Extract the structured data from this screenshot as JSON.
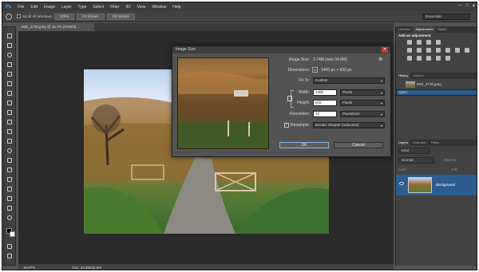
{
  "app": {
    "logo": "Ps",
    "menu": [
      "File",
      "Edit",
      "Image",
      "Layer",
      "Type",
      "Select",
      "Filter",
      "3D",
      "View",
      "Window",
      "Help"
    ],
    "window_controls": [
      "—",
      "□",
      "✕"
    ]
  },
  "options_bar": {
    "scroll_all_windows": "Scroll All Windows",
    "buttons": [
      "100%",
      "Fit Screen",
      "Fill Screen"
    ],
    "workspace": "Essentials"
  },
  "document": {
    "tab_title": "IMG_3730.jpeg @ 16.7% (RGB/8)",
    "zoom": "16.67%",
    "doc_info": "Doc: 34.8M/34.8M"
  },
  "right_panel": {
    "top_tabs": [
      "Libraries",
      "Adjustments",
      "Styles"
    ],
    "adjustments_title": "Add an adjustment",
    "history_tabs": [
      "History",
      "Actions"
    ],
    "history_items": [
      "IMG_3730.jpeg",
      "Open"
    ],
    "layers_tabs": [
      "Layers",
      "Channels",
      "Paths"
    ],
    "layer_filter": "Kind",
    "blend_mode": "Normal",
    "opacity_label": "Opacity:",
    "lock_label": "Lock:",
    "fill_label": "Fill:",
    "layer_name": "Background"
  },
  "dialog": {
    "title": "Image Size",
    "close": "✕",
    "image_size_label": "Image Size:",
    "image_size_value": "3.74M (was 34.8M)",
    "dimensions_label": "Dimensions:",
    "dimensions_value": "1400 px  ×  933 px",
    "fit_to_label": "Fit To:",
    "fit_to_value": "Custom",
    "width_label": "Width:",
    "width_value": "1400",
    "width_unit": "Pixels",
    "height_label": "Height:",
    "height_value": "933",
    "height_unit": "Pixels",
    "resolution_label": "Resolution:",
    "resolution_value": "72",
    "resolution_unit": "Pixels/Inch",
    "resample_label": "Resample:",
    "resample_value": "Bicubic Sharper (reduction)",
    "ok_label": "OK",
    "cancel_label": "Cancel"
  },
  "colors": {
    "accent": "#31a8ff",
    "selection": "#2d5c8f",
    "workspace_bg": "#535353"
  }
}
